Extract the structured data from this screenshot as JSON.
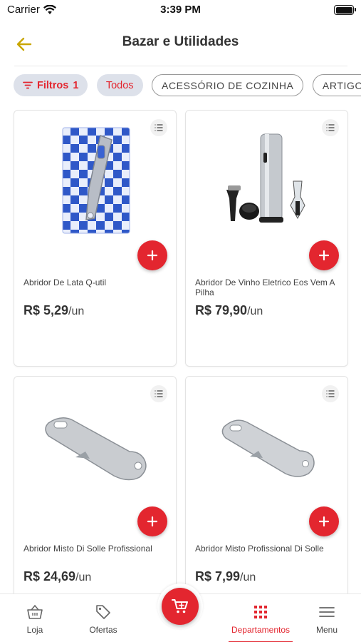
{
  "status_bar": {
    "carrier": "Carrier",
    "time": "3:39 PM"
  },
  "header": {
    "title": "Bazar e Utilidades",
    "back_icon": "arrow-left-icon"
  },
  "chips": {
    "filter_label": "Filtros",
    "filter_count": "1",
    "items": [
      "Todos",
      "ACESSÓRIO DE COZINHA",
      "ARTIGO"
    ]
  },
  "products": [
    {
      "name": "Abridor De Lata Q-util",
      "price": "R$ 5,29",
      "unit": "/un"
    },
    {
      "name": "Abridor De Vinho Eletrico Eos Vem A Pilha",
      "price": "R$ 79,90",
      "unit": "/un"
    },
    {
      "name": "Abridor Misto Di Solle Profissional",
      "price": "R$ 24,69",
      "unit": "/un"
    },
    {
      "name": "Abridor Misto Profissional Di Solle",
      "price": "R$ 7,99",
      "unit": "/un"
    }
  ],
  "bottom_nav": {
    "items": [
      {
        "label": "Loja",
        "icon": "basket-icon"
      },
      {
        "label": "Ofertas",
        "icon": "tag-icon"
      },
      {
        "label": "Departamentos",
        "icon": "grid-icon"
      },
      {
        "label": "Menu",
        "icon": "hamburger-icon"
      }
    ],
    "active": "Departamentos"
  },
  "colors": {
    "accent": "#e3262f",
    "back_arrow": "#c9a600",
    "chip_bg": "#dde1ea"
  }
}
